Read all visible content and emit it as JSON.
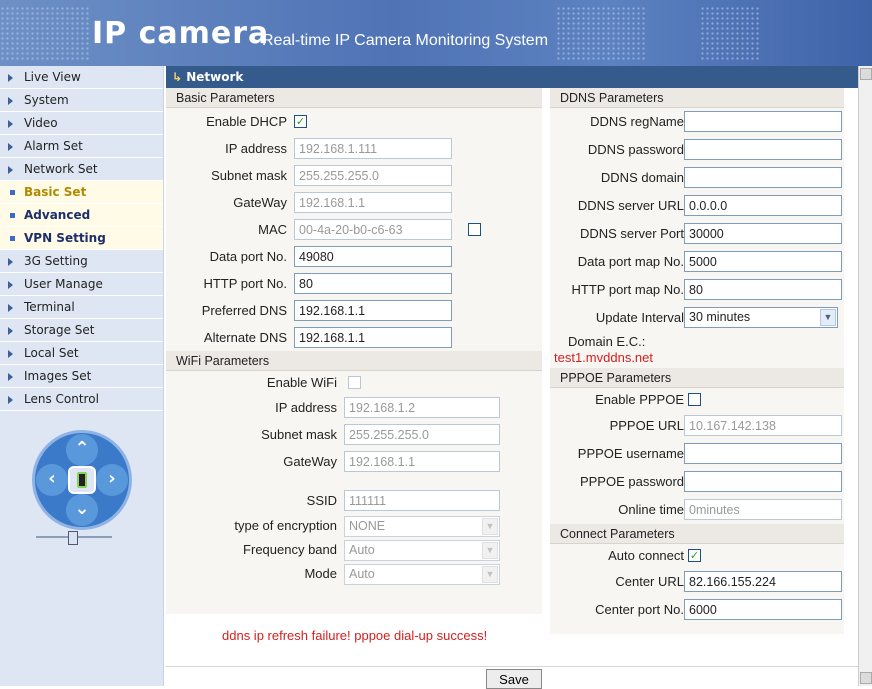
{
  "header": {
    "logo": "IP camera",
    "tagline": "Real-time IP Camera Monitoring System"
  },
  "sidebar": {
    "items": [
      {
        "label": "Live View",
        "type": "main"
      },
      {
        "label": "System",
        "type": "main"
      },
      {
        "label": "Video",
        "type": "main"
      },
      {
        "label": "Alarm Set",
        "type": "main"
      },
      {
        "label": "Network Set",
        "type": "main"
      },
      {
        "label": "Basic Set",
        "type": "sub",
        "active": true
      },
      {
        "label": "Advanced",
        "type": "sub"
      },
      {
        "label": "VPN Setting",
        "type": "sub"
      },
      {
        "label": "3G Setting",
        "type": "main"
      },
      {
        "label": "User Manage",
        "type": "main"
      },
      {
        "label": "Terminal",
        "type": "main"
      },
      {
        "label": "Storage Set",
        "type": "main"
      },
      {
        "label": "Local Set",
        "type": "main"
      },
      {
        "label": "Images Set",
        "type": "main"
      },
      {
        "label": "Lens Control",
        "type": "main"
      }
    ]
  },
  "page_title": "Network",
  "basic": {
    "heading": "Basic Parameters",
    "enable_dhcp_label": "Enable DHCP",
    "enable_dhcp_checked": true,
    "ip_label": "IP address",
    "ip_value": "192.168.1.111",
    "subnet_label": "Subnet mask",
    "subnet_value": "255.255.255.0",
    "gateway_label": "GateWay",
    "gateway_value": "192.168.1.1",
    "mac_label": "MAC",
    "mac_value": "00-4a-20-b0-c6-63",
    "data_port_label": "Data port No.",
    "data_port_value": "49080",
    "http_port_label": "HTTP port No.",
    "http_port_value": "80",
    "pref_dns_label": "Preferred DNS",
    "pref_dns_value": "192.168.1.1",
    "alt_dns_label": "Alternate DNS",
    "alt_dns_value": "192.168.1.1"
  },
  "wifi": {
    "heading": "WiFi Parameters",
    "enable_label": "Enable WiFi",
    "ip_label": "IP address",
    "ip_value": "192.168.1.2",
    "subnet_label": "Subnet mask",
    "subnet_value": "255.255.255.0",
    "gateway_label": "GateWay",
    "gateway_value": "192.168.1.1",
    "ssid_label": "SSID",
    "ssid_value": "111111",
    "encryption_label": "type of encryption",
    "encryption_value": "NONE",
    "band_label": "Frequency band",
    "band_value": "Auto",
    "mode_label": "Mode",
    "mode_value": "Auto"
  },
  "ddns": {
    "heading": "DDNS Parameters",
    "regname_label": "DDNS regName",
    "regname_value": "",
    "password_label": "DDNS password",
    "password_value": "",
    "domain_label": "DDNS domain",
    "domain_value": "",
    "server_url_label": "DDNS server URL",
    "server_url_value": "0.0.0.0",
    "server_port_label": "DDNS server Port",
    "server_port_value": "30000",
    "data_map_label": "Data port map No.",
    "data_map_value": "5000",
    "http_map_label": "HTTP port map No.",
    "http_map_value": "80",
    "update_label": "Update Interval",
    "update_value": "30 minutes",
    "domain_ec_label": "Domain E.C.:",
    "domain_ec_value": "test1.mvddns.net"
  },
  "pppoe": {
    "heading": "PPPOE Parameters",
    "enable_label": "Enable PPPOE",
    "url_label": "PPPOE URL",
    "url_value": "10.167.142.138",
    "username_label": "PPPOE username",
    "username_value": "",
    "password_label": "PPPOE password",
    "password_value": "",
    "online_label": "Online time",
    "online_value": "0minutes"
  },
  "connect": {
    "heading": "Connect Parameters",
    "auto_label": "Auto connect",
    "auto_checked": true,
    "center_url_label": "Center URL",
    "center_url_value": "82.166.155.224",
    "center_port_label": "Center port No.",
    "center_port_value": "6000"
  },
  "status_message": "ddns ip refresh failure! pppoe dial-up success!",
  "save_label": "Save"
}
